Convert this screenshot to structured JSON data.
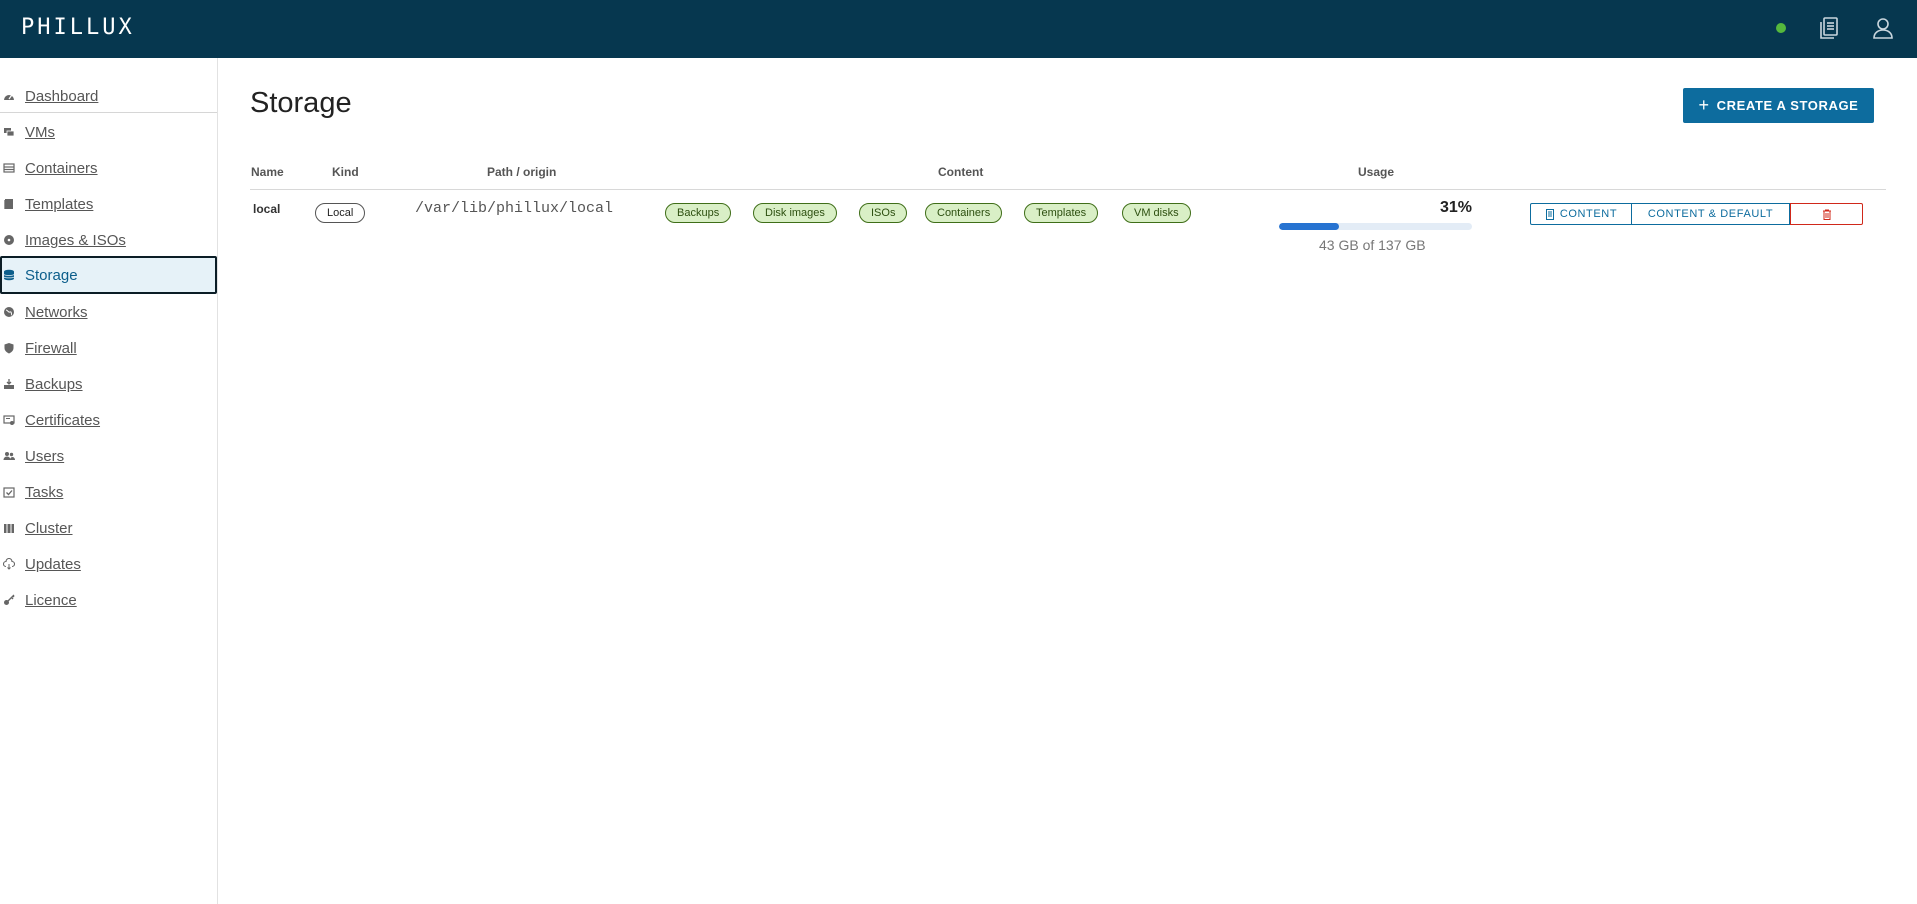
{
  "header": {
    "logo": "PHILLUX",
    "status_color": "#55b83d",
    "icons": [
      "documents-icon",
      "user-icon"
    ]
  },
  "sidebar": {
    "items": [
      {
        "label": "Dashboard",
        "icon": "dashboard-icon",
        "active": false
      },
      {
        "label": "VMs",
        "icon": "vm-icon",
        "active": false
      },
      {
        "label": "Containers",
        "icon": "container-icon",
        "active": false
      },
      {
        "label": "Templates",
        "icon": "template-icon",
        "active": false
      },
      {
        "label": "Images & ISOs",
        "icon": "disc-icon",
        "active": false
      },
      {
        "label": "Storage",
        "icon": "database-icon",
        "active": true
      },
      {
        "label": "Networks",
        "icon": "network-icon",
        "active": false
      },
      {
        "label": "Firewall",
        "icon": "shield-icon",
        "active": false
      },
      {
        "label": "Backups",
        "icon": "backup-icon",
        "active": false
      },
      {
        "label": "Certificates",
        "icon": "certificate-icon",
        "active": false
      },
      {
        "label": "Users",
        "icon": "users-icon",
        "active": false
      },
      {
        "label": "Tasks",
        "icon": "tasks-icon",
        "active": false
      },
      {
        "label": "Cluster",
        "icon": "cluster-icon",
        "active": false
      },
      {
        "label": "Updates",
        "icon": "cloud-download-icon",
        "active": false
      },
      {
        "label": "Licence",
        "icon": "key-icon",
        "active": false
      }
    ]
  },
  "main": {
    "title": "Storage",
    "create_button": "CREATE A STORAGE",
    "table": {
      "headers": {
        "name": "Name",
        "kind": "Kind",
        "path": "Path / origin",
        "content": "Content",
        "usage": "Usage"
      },
      "rows": [
        {
          "name": "local",
          "kind": "Local",
          "path": "/var/lib/phillux/local",
          "content": [
            "Backups",
            "Disk images",
            "ISOs",
            "Containers",
            "Templates",
            "VM disks"
          ],
          "usage_percent": "31%",
          "usage_fraction": 0.31,
          "usage_text": "43 GB of 137 GB",
          "actions": {
            "content": "CONTENT",
            "content_default": "CONTENT & DEFAULT",
            "delete_icon": "trash-icon"
          }
        }
      ]
    }
  },
  "colors": {
    "header_bg": "#06374f",
    "accent": "#0d6c9e",
    "danger": "#d0281a",
    "tag_bg": "#d9efc6",
    "progress": "#2773d1"
  }
}
